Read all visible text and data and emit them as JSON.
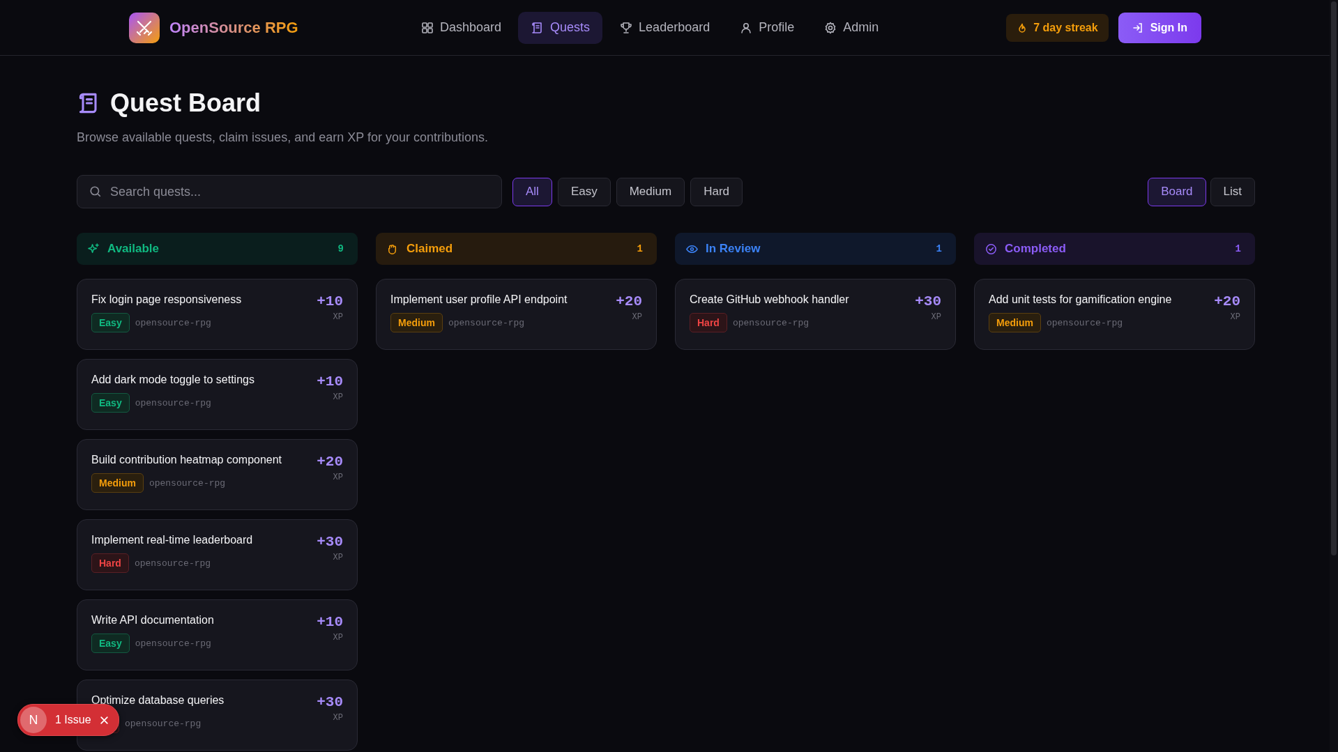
{
  "brand": {
    "name": "OpenSource RPG"
  },
  "nav": [
    {
      "label": "Dashboard",
      "selected": false
    },
    {
      "label": "Quests",
      "selected": true
    },
    {
      "label": "Leaderboard",
      "selected": false
    },
    {
      "label": "Profile",
      "selected": false
    },
    {
      "label": "Admin",
      "selected": false
    }
  ],
  "streak": "7 day streak",
  "sign_in": "Sign In",
  "page": {
    "title": "Quest Board",
    "subtitle": "Browse available quests, claim issues, and earn XP for your contributions."
  },
  "search": {
    "placeholder": "Search quests..."
  },
  "filters": [
    {
      "label": "All",
      "selected": true
    },
    {
      "label": "Easy",
      "selected": false
    },
    {
      "label": "Medium",
      "selected": false
    },
    {
      "label": "Hard",
      "selected": false
    }
  ],
  "views": [
    {
      "label": "Board",
      "selected": true
    },
    {
      "label": "List",
      "selected": false
    }
  ],
  "columns": [
    {
      "label": "Available",
      "count": "9",
      "color": "#10b981",
      "cards": [
        {
          "title": "Fix login page responsiveness",
          "xp": "+10",
          "unit": "XP",
          "difficulty": {
            "kind": "easy",
            "label": "Easy"
          },
          "repo": "opensource-rpg"
        },
        {
          "title": "Add dark mode toggle to settings",
          "xp": "+10",
          "unit": "XP",
          "difficulty": {
            "kind": "easy",
            "label": "Easy"
          },
          "repo": "opensource-rpg"
        },
        {
          "title": "Build contribution heatmap component",
          "xp": "+20",
          "unit": "XP",
          "difficulty": {
            "kind": "medium",
            "label": "Medium"
          },
          "repo": "opensource-rpg"
        },
        {
          "title": "Implement real-time leaderboard",
          "xp": "+30",
          "unit": "XP",
          "difficulty": {
            "kind": "hard",
            "label": "Hard"
          },
          "repo": "opensource-rpg"
        },
        {
          "title": "Write API documentation",
          "xp": "+10",
          "unit": "XP",
          "difficulty": {
            "kind": "easy",
            "label": "Easy"
          },
          "repo": "opensource-rpg"
        },
        {
          "title": "Optimize database queries",
          "xp": "+30",
          "unit": "XP",
          "difficulty": {
            "kind": "hard"
          },
          "repo": "opensource-rpg"
        }
      ]
    },
    {
      "label": "Claimed",
      "count": "1",
      "color": "#f59e0b",
      "cards": [
        {
          "title": "Implement user profile API endpoint",
          "xp": "+20",
          "unit": "XP",
          "difficulty": {
            "kind": "medium",
            "label": "Medium"
          },
          "repo": "opensource-rpg"
        }
      ]
    },
    {
      "label": "In Review",
      "count": "1",
      "color": "#3b82f6",
      "cards": [
        {
          "title": "Create GitHub webhook handler",
          "xp": "+30",
          "unit": "XP",
          "difficulty": {
            "kind": "hard",
            "label": "Hard"
          },
          "repo": "opensource-rpg"
        }
      ]
    },
    {
      "label": "Completed",
      "count": "1",
      "color": "#8b5cf6",
      "cards": [
        {
          "title": "Add unit tests for gamification engine",
          "xp": "+20",
          "unit": "XP",
          "difficulty": {
            "kind": "medium",
            "label": "Medium"
          },
          "repo": "opensource-rpg"
        }
      ]
    }
  ],
  "toast": {
    "logo": "N",
    "label": "1 Issue"
  }
}
